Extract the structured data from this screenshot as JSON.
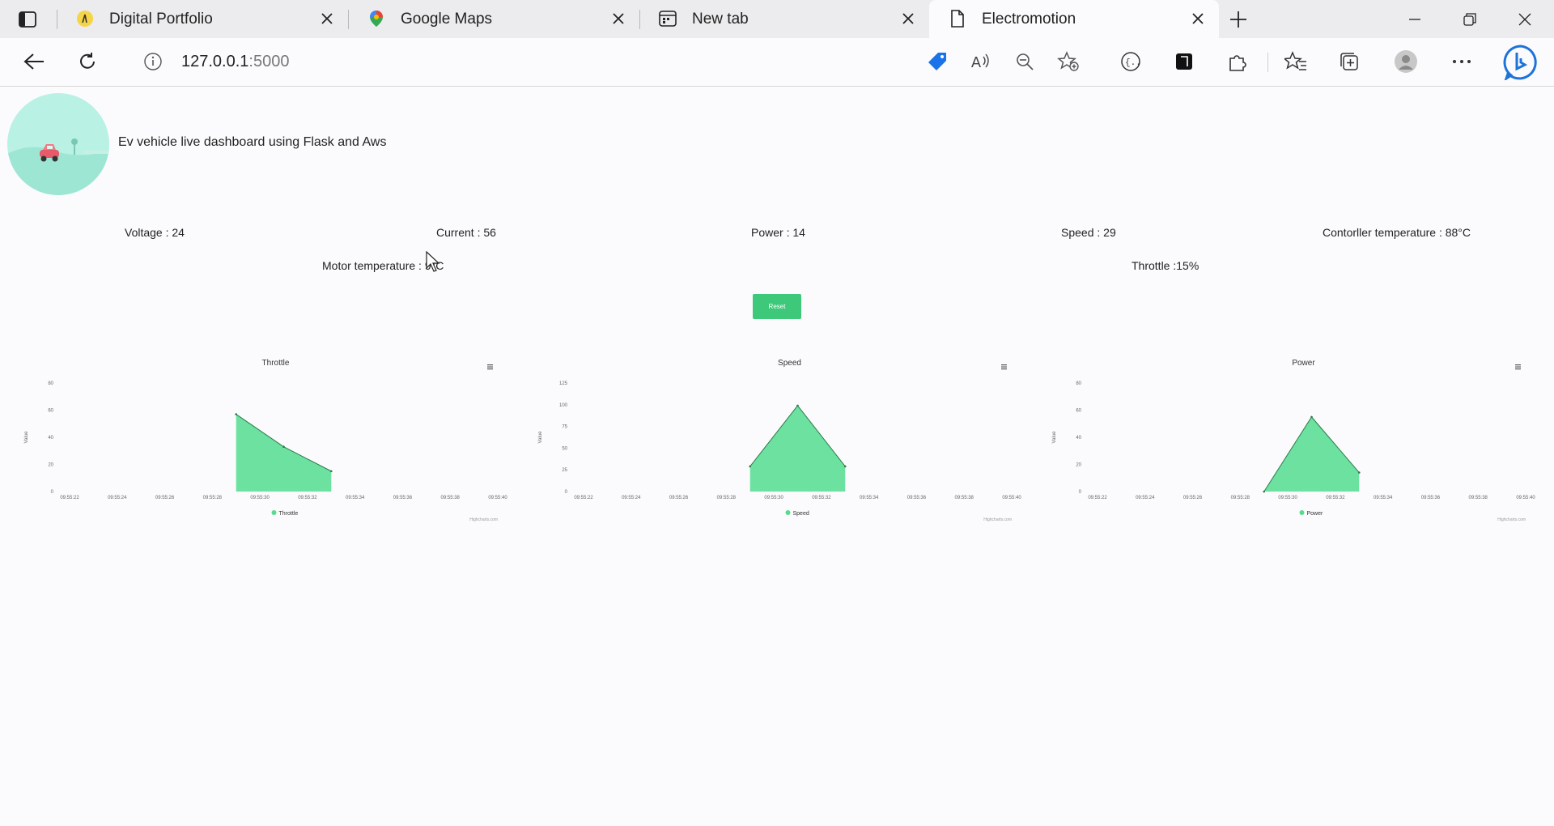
{
  "browser": {
    "tabs": [
      {
        "title": "Digital Portfolio",
        "icon": "portfolio-favicon",
        "active": false
      },
      {
        "title": "Google Maps",
        "icon": "maps-pin-icon",
        "active": false
      },
      {
        "title": "New tab",
        "icon": "newtab-icon",
        "active": false
      },
      {
        "title": "Electromotion",
        "icon": "page-icon",
        "active": true
      }
    ],
    "url_host": "127.0.0.1",
    "url_port": ":5000"
  },
  "page": {
    "subtitle": "Ev vehicle live dashboard using Flask and Aws",
    "stats": {
      "voltage": "Voltage : 24",
      "current": "Current : 56",
      "power": "Power : 14",
      "speed": "Speed : 29",
      "controller_temp": "Contorller temperature : 88°C",
      "motor_temp": "Motor temperature : 9°C",
      "throttle": "Throttle :15%"
    },
    "reset_label": "Reset",
    "accent_color": "#3ec97a"
  },
  "chart_data": [
    {
      "type": "area",
      "title": "Throttle",
      "ylabel": "Value",
      "ylim": [
        0,
        80
      ],
      "yticks": [
        0,
        20,
        40,
        60,
        80
      ],
      "xticks": [
        "09:55:22",
        "09:55:24",
        "09:55:26",
        "09:55:28",
        "09:55:30",
        "09:55:32",
        "09:55:34",
        "09:55:36",
        "09:55:38",
        "09:55:40"
      ],
      "x": [
        "09:55:29",
        "09:55:31",
        "09:55:33"
      ],
      "series": [
        {
          "name": "Throttle",
          "values": [
            57,
            33,
            15
          ]
        }
      ],
      "legend": "bottom",
      "credit": "Highcharts.com",
      "color": "#54dc8f"
    },
    {
      "type": "area",
      "title": "Speed",
      "ylabel": "Value",
      "ylim": [
        0,
        125
      ],
      "yticks": [
        0,
        25,
        50,
        75,
        100,
        125
      ],
      "xticks": [
        "09:55:22",
        "09:55:24",
        "09:55:26",
        "09:55:28",
        "09:55:30",
        "09:55:32",
        "09:55:34",
        "09:55:36",
        "09:55:38",
        "09:55:40"
      ],
      "x": [
        "09:55:29",
        "09:55:31",
        "09:55:33"
      ],
      "series": [
        {
          "name": "Speed",
          "values": [
            29,
            99,
            29
          ]
        }
      ],
      "legend": "bottom",
      "credit": "Highcharts.com",
      "color": "#54dc8f"
    },
    {
      "type": "area",
      "title": "Power",
      "ylabel": "Value",
      "ylim": [
        0,
        80
      ],
      "yticks": [
        0,
        20,
        40,
        60,
        80
      ],
      "xticks": [
        "09:55:22",
        "09:55:24",
        "09:55:26",
        "09:55:28",
        "09:55:30",
        "09:55:32",
        "09:55:34",
        "09:55:36",
        "09:55:38",
        "09:55:40"
      ],
      "x": [
        "09:55:29",
        "09:55:31",
        "09:55:33"
      ],
      "series": [
        {
          "name": "Power",
          "values": [
            0,
            55,
            14
          ]
        }
      ],
      "legend": "bottom",
      "credit": "Highcharts.com",
      "color": "#54dc8f"
    }
  ]
}
